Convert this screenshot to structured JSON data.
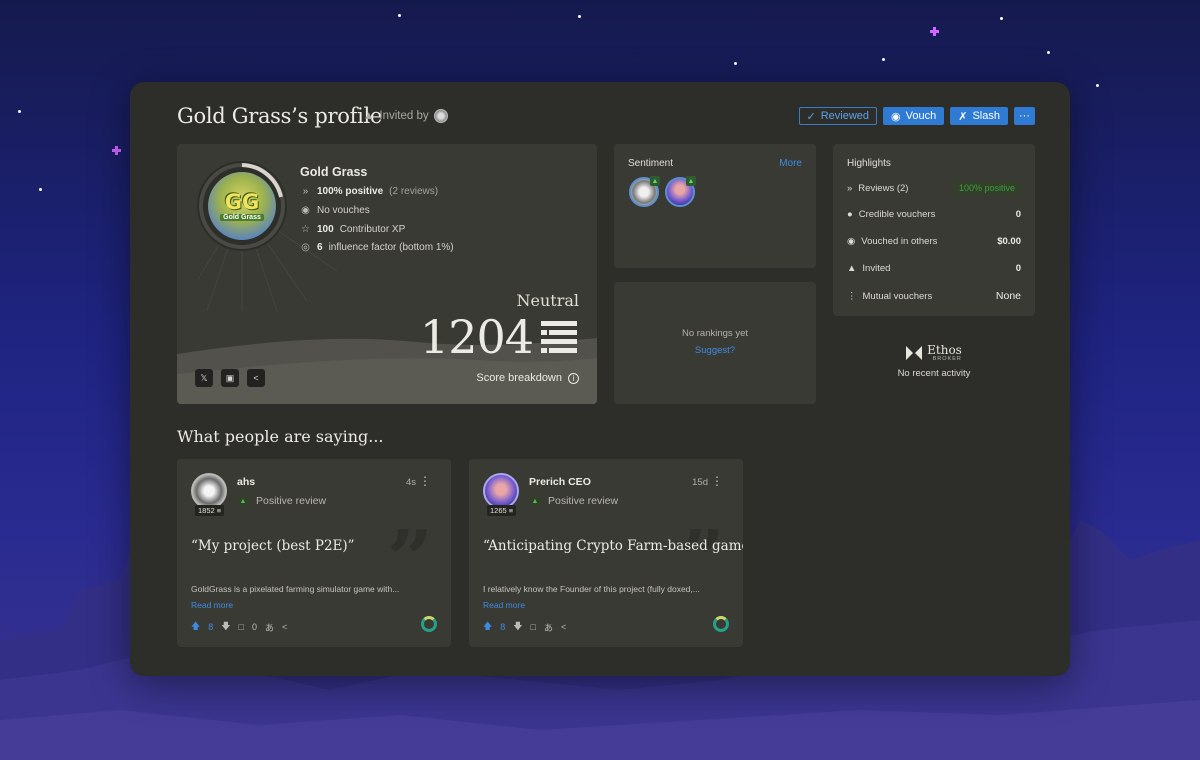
{
  "profile": {
    "title": "Gold Grass’s profile",
    "invited_label": "Invited by",
    "name": "Gold Grass",
    "avatar_text": "GG",
    "avatar_subtext": "Gold Grass",
    "positive": "100% positive",
    "reviews_count": "(2 reviews)",
    "vouches": "No vouches",
    "xp_value": "100",
    "xp_label": "Contributor XP",
    "influence_value": "6",
    "influence_label": "influence factor (bottom 1%)",
    "level": "Neutral",
    "score": "1204",
    "score_breakdown": "Score breakdown"
  },
  "actions": {
    "reviewed": "Reviewed",
    "vouch": "Vouch",
    "slash": "Slash",
    "more": "···"
  },
  "sentiment": {
    "title": "Sentiment",
    "more": "More"
  },
  "rankings": {
    "empty": "No rankings yet",
    "suggest": "Suggest?"
  },
  "highlights": {
    "title": "Highlights",
    "reviews_label": "Reviews (2)",
    "reviews_badge": "100% positive",
    "credible_label": "Credible vouchers",
    "credible_value": "0",
    "vouched_label": "Vouched in others",
    "vouched_value": "$0.00",
    "invited_label": "Invited",
    "invited_value": "0",
    "mutual_label": "Mutual vouchers",
    "mutual_value": "None"
  },
  "ethos": {
    "name": "Ethos",
    "sub": "BROKER",
    "activity": "No recent activity"
  },
  "section_title": "What people are saying...",
  "reviews": [
    {
      "author": "ahs",
      "score": "1852",
      "type": "Positive review",
      "time": "4s",
      "quote": "“My project (best P2E)”",
      "snippet": "GoldGrass is a pixelated farming simulator game with...",
      "read_more": "Read more",
      "upvotes": "8",
      "comments": "0"
    },
    {
      "author": "Prerich CEO",
      "score": "1265",
      "type": "Positive review",
      "time": "15d",
      "quote": "“Anticipating Crypto Farm-based game”",
      "snippet": "I relatively know the Founder of this project (fully doxed,...",
      "read_more": "Read more",
      "upvotes": "8",
      "comments": ""
    }
  ],
  "colors": {
    "accent": "#2f7bd4",
    "link": "#3d8be0",
    "positive": "#3aa03c",
    "panel": "#2d2d29",
    "card": "#3a3a35"
  }
}
